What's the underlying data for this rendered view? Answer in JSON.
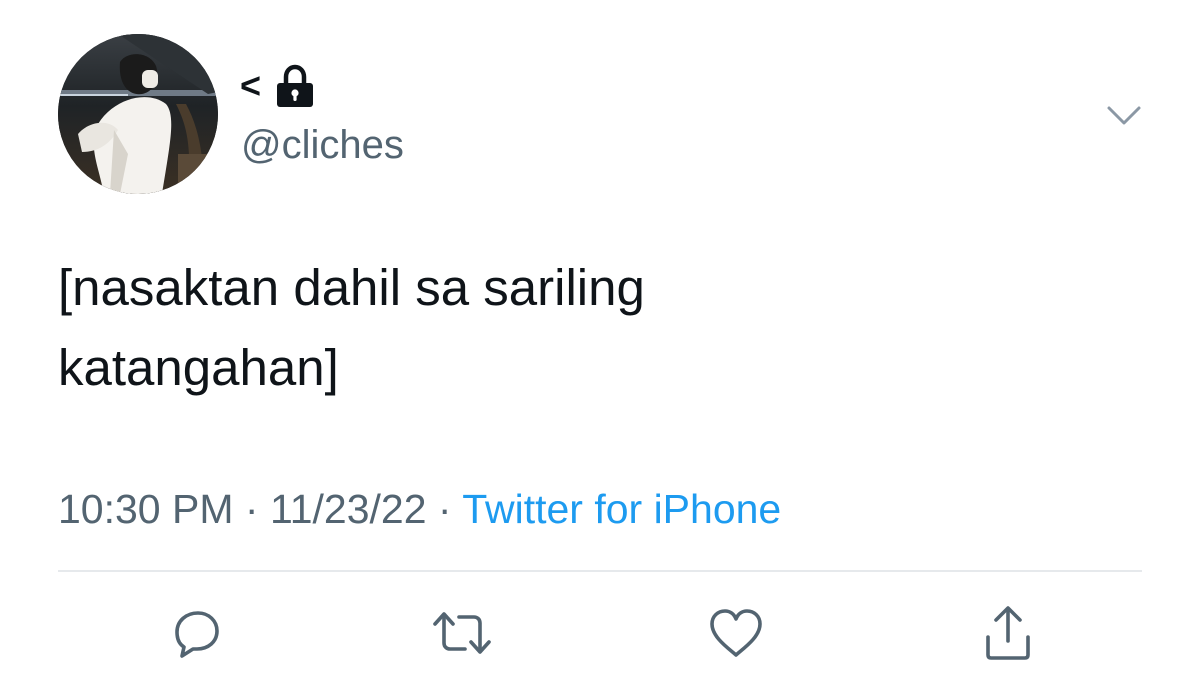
{
  "tweet": {
    "display_name": "<",
    "handle": "@cliches",
    "text": "[nasaktan dahil sa sariling\nkatangahan]",
    "time": "10:30 PM",
    "separator": " · ",
    "date": "11/23/22",
    "source": "Twitter for iPhone"
  },
  "icons": {
    "lock": "lock-icon",
    "more": "chevron-down-icon",
    "reply": "reply-icon",
    "retweet": "retweet-icon",
    "like": "heart-icon",
    "share": "share-icon"
  },
  "colors": {
    "text": "#0f1419",
    "secondary": "#536471",
    "link": "#1d9bf0",
    "divider": "#e6e9ec"
  }
}
